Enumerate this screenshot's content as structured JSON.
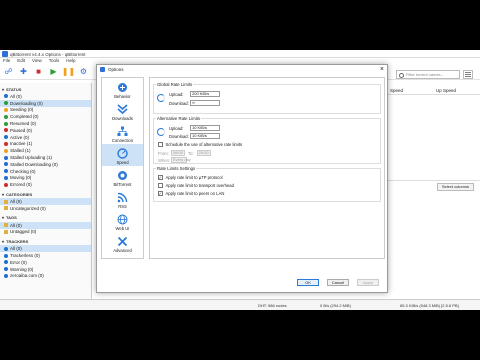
{
  "window": {
    "title": "qBittorrent v4.4.x Options - qBittorrent",
    "menu": [
      "File",
      "Edit",
      "View",
      "Tools",
      "Help"
    ]
  },
  "toolbar": {
    "icons": [
      "add-link-icon",
      "add-torrent-icon",
      "remove-icon",
      "resume-icon",
      "pause-icon",
      "settings-icon"
    ]
  },
  "search": {
    "placeholder": "Filter torrent names..."
  },
  "sidebar": {
    "status": {
      "title": "STATUS",
      "items": [
        {
          "label": "All (0)",
          "color": "#1f6fd0"
        },
        {
          "label": "Downloading (0)",
          "color": "#2a9d3a"
        },
        {
          "label": "Seeding (0)",
          "color": "#f0a020"
        },
        {
          "label": "Completed (0)",
          "color": "#2a9d3a"
        },
        {
          "label": "Resumed (0)",
          "color": "#2a9d3a"
        },
        {
          "label": "Paused (0)",
          "color": "#d12b2b"
        },
        {
          "label": "Active (0)",
          "color": "#1f6fd0"
        },
        {
          "label": "Inactive (1)",
          "color": "#d12b2b"
        },
        {
          "label": "Stalled (1)",
          "color": "#f0a020"
        },
        {
          "label": "Stalled Uploading (1)",
          "color": "#1f6fd0"
        },
        {
          "label": "Stalled Downloading (0)",
          "color": "#1f6fd0"
        },
        {
          "label": "Checking (0)",
          "color": "#1f6fd0"
        },
        {
          "label": "Moving (0)",
          "color": "#1f6fd0"
        },
        {
          "label": "Errored (0)",
          "color": "#d12b2b"
        }
      ]
    },
    "categories": {
      "title": "CATEGORIES",
      "items": [
        {
          "label": "All (0)"
        },
        {
          "label": "Uncategorized (0)"
        }
      ]
    },
    "tags": {
      "title": "TAGS",
      "items": [
        {
          "label": "All (0)"
        },
        {
          "label": "Untagged (0)"
        }
      ]
    },
    "trackers": {
      "title": "TRACKERS",
      "items": [
        {
          "label": "All (0)"
        },
        {
          "label": "Trackerless (0)"
        },
        {
          "label": "Error (0)"
        },
        {
          "label": "Warning (0)"
        },
        {
          "label": "zeroaiba.com (0)"
        }
      ]
    }
  },
  "list": {
    "columns": [
      "Speed",
      "Up Speed"
    ],
    "select_columns": "Select columns"
  },
  "statusbar": {
    "dht": "DHT: 586 nodes",
    "down": "0 B/s (294.2 MiB)",
    "up": "85.3 KiB/s (548.3 MiB) [2.5.6 PB]"
  },
  "dialog": {
    "title": "Options",
    "nav": [
      {
        "label": "Behavior",
        "icon": "behavior-icon"
      },
      {
        "label": "Downloads",
        "icon": "downloads-icon"
      },
      {
        "label": "Connection",
        "icon": "connection-icon"
      },
      {
        "label": "Speed",
        "icon": "speed-icon"
      },
      {
        "label": "BitTorrent",
        "icon": "bittorrent-icon"
      },
      {
        "label": "RSS",
        "icon": "rss-icon"
      },
      {
        "label": "Web UI",
        "icon": "webui-icon"
      },
      {
        "label": "Advanced",
        "icon": "advanced-icon"
      }
    ],
    "global": {
      "title": "Global Rate Limits",
      "upload_label": "Upload:",
      "upload_value": "200 KiB/s",
      "download_label": "Download:",
      "download_value": "∞"
    },
    "alternative": {
      "title": "Alternative Rate Limits",
      "upload_label": "Upload:",
      "upload_value": "10 KiB/s",
      "download_label": "Download:",
      "download_value": "10 KiB/s",
      "schedule_label": "Schedule the use of alternative rate limits",
      "from_label": "From:",
      "from_value": "08:00",
      "to_label": "To:",
      "to_value": "20:00",
      "when_label": "When:",
      "when_value": "Every day"
    },
    "settings": {
      "title": "Rate Limits Settings",
      "options": [
        {
          "label": "Apply rate limit to µTP protocol",
          "checked": true
        },
        {
          "label": "Apply rate limit to transport overhead",
          "checked": false
        },
        {
          "label": "Apply rate limit to peers on LAN",
          "checked": true
        }
      ]
    },
    "buttons": {
      "ok": "OK",
      "cancel": "Cancel",
      "apply": "Apply"
    }
  }
}
